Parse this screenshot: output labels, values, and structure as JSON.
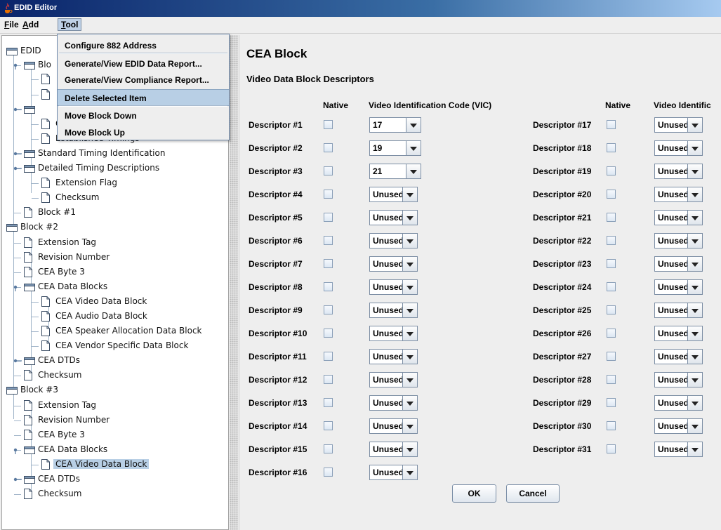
{
  "window": {
    "title": "EDID Editor"
  },
  "menubar": [
    {
      "key": "F",
      "rest": "ile"
    },
    {
      "key": "A",
      "rest": "dd"
    },
    {
      "key": "T",
      "rest": "ool"
    }
  ],
  "tool_menu": {
    "items": [
      "Configure 882 Address",
      "Generate/View EDID Data Report...",
      "Generate/View Compliance Report...",
      "Delete Selected Item",
      "Move Block Down",
      "Move Block Up"
    ],
    "selected": "Delete Selected Item"
  },
  "tree": {
    "nodes": [
      {
        "label": "EDID",
        "type": "folder"
      },
      {
        "label": "Blo",
        "type": "folder"
      },
      {
        "label": "",
        "type": "doc"
      },
      {
        "label": "",
        "type": "doc"
      },
      {
        "label": "",
        "type": "folder"
      },
      {
        "label": "Color Characteristics",
        "type": "doc"
      },
      {
        "label": "Established Timings",
        "type": "doc"
      },
      {
        "label": "Standard Timing Identification",
        "type": "folder"
      },
      {
        "label": "Detailed Timing Descriptions",
        "type": "folder"
      },
      {
        "label": "Extension Flag",
        "type": "doc"
      },
      {
        "label": "Checksum",
        "type": "doc"
      },
      {
        "label": "Block #1",
        "type": "doc"
      },
      {
        "label": "Block #2",
        "type": "folder"
      },
      {
        "label": "Extension Tag",
        "type": "doc"
      },
      {
        "label": "Revision Number",
        "type": "doc"
      },
      {
        "label": "CEA Byte 3",
        "type": "doc"
      },
      {
        "label": "CEA Data Blocks",
        "type": "folder"
      },
      {
        "label": "CEA Video Data Block",
        "type": "doc"
      },
      {
        "label": "CEA Audio Data Block",
        "type": "doc"
      },
      {
        "label": "CEA Speaker Allocation Data Block",
        "type": "doc"
      },
      {
        "label": "CEA Vendor Specific Data Block",
        "type": "doc"
      },
      {
        "label": "CEA DTDs",
        "type": "folder"
      },
      {
        "label": "Checksum",
        "type": "doc"
      },
      {
        "label": "Block #3",
        "type": "folder"
      },
      {
        "label": "Extension Tag",
        "type": "doc"
      },
      {
        "label": "Revision Number",
        "type": "doc"
      },
      {
        "label": "CEA Byte 3",
        "type": "doc"
      },
      {
        "label": "CEA Data Blocks",
        "type": "folder"
      },
      {
        "label": "CEA Video Data Block",
        "type": "doc",
        "selected": true
      },
      {
        "label": "CEA DTDs",
        "type": "folder"
      },
      {
        "label": "Checksum",
        "type": "doc"
      }
    ]
  },
  "panel": {
    "title": "CEA Block",
    "subtitle": "Video Data Block Descriptors",
    "col_native": "Native",
    "col_vic_left": "Video Identification Code (VIC)",
    "col_vic_right": "Video Identific",
    "left": [
      {
        "label": "Descriptor #1",
        "value": "17"
      },
      {
        "label": "Descriptor #2",
        "value": "19"
      },
      {
        "label": "Descriptor #3",
        "value": "21"
      },
      {
        "label": "Descriptor #4",
        "value": "Unused"
      },
      {
        "label": "Descriptor #5",
        "value": "Unused"
      },
      {
        "label": "Descriptor #6",
        "value": "Unused"
      },
      {
        "label": "Descriptor #7",
        "value": "Unused"
      },
      {
        "label": "Descriptor #8",
        "value": "Unused"
      },
      {
        "label": "Descriptor #9",
        "value": "Unused"
      },
      {
        "label": "Descriptor #10",
        "value": "Unused"
      },
      {
        "label": "Descriptor #11",
        "value": "Unused"
      },
      {
        "label": "Descriptor #12",
        "value": "Unused"
      },
      {
        "label": "Descriptor #13",
        "value": "Unused"
      },
      {
        "label": "Descriptor #14",
        "value": "Unused"
      },
      {
        "label": "Descriptor #15",
        "value": "Unused"
      },
      {
        "label": "Descriptor #16",
        "value": "Unused"
      }
    ],
    "right": [
      {
        "label": "Descriptor #17",
        "value": "Unused"
      },
      {
        "label": "Descriptor #18",
        "value": "Unused"
      },
      {
        "label": "Descriptor #19",
        "value": "Unused"
      },
      {
        "label": "Descriptor #20",
        "value": "Unused"
      },
      {
        "label": "Descriptor #21",
        "value": "Unused"
      },
      {
        "label": "Descriptor #22",
        "value": "Unused"
      },
      {
        "label": "Descriptor #23",
        "value": "Unused"
      },
      {
        "label": "Descriptor #24",
        "value": "Unused"
      },
      {
        "label": "Descriptor #25",
        "value": "Unused"
      },
      {
        "label": "Descriptor #26",
        "value": "Unused"
      },
      {
        "label": "Descriptor #27",
        "value": "Unused"
      },
      {
        "label": "Descriptor #28",
        "value": "Unused"
      },
      {
        "label": "Descriptor #29",
        "value": "Unused"
      },
      {
        "label": "Descriptor #30",
        "value": "Unused"
      },
      {
        "label": "Descriptor #31",
        "value": "Unused"
      }
    ],
    "ok_label": "OK",
    "cancel_label": "Cancel"
  },
  "colors": {
    "titlebar": "#0a246a",
    "selection": "#b8cfe5",
    "panel_bg": "#eeeeee"
  }
}
